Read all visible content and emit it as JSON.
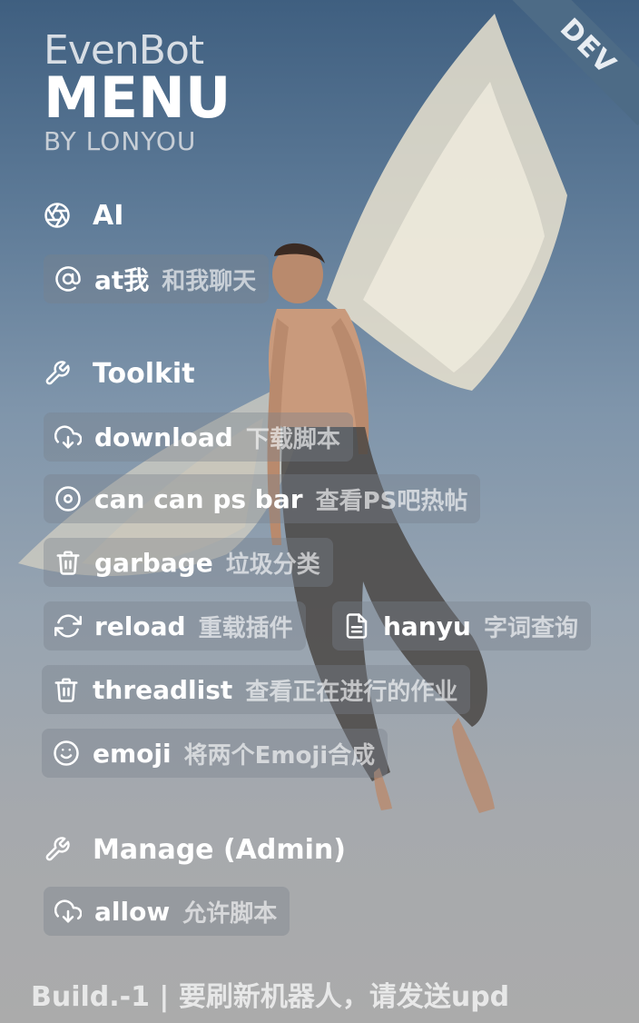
{
  "ribbon": {
    "label": "DEV"
  },
  "logo": {
    "line1": "EvenBot",
    "line2": "MENU",
    "line3": "BY LONYOU"
  },
  "sections": {
    "ai": {
      "title": "AI",
      "icon": "aperture-icon"
    },
    "toolkit": {
      "title": "Toolkit",
      "icon": "wrench-icon"
    },
    "manage": {
      "title": "Manage (Admin)",
      "icon": "wrench-icon"
    }
  },
  "commands": {
    "at": {
      "cmd": "at我",
      "desc": "和我聊天",
      "icon": "at-icon"
    },
    "download": {
      "cmd": "download",
      "desc": "下载脚本",
      "icon": "cloud-download-icon"
    },
    "canps": {
      "cmd": "can can ps bar",
      "desc": "查看PS吧热帖",
      "icon": "disc-icon"
    },
    "garbage": {
      "cmd": "garbage",
      "desc": "垃圾分类",
      "icon": "trash-icon"
    },
    "reload": {
      "cmd": "reload",
      "desc": "重载插件",
      "icon": "refresh-icon"
    },
    "hanyu": {
      "cmd": "hanyu",
      "desc": "字词查询",
      "icon": "document-icon"
    },
    "threadlist": {
      "cmd": "threadlist",
      "desc": "查看正在进行的作业",
      "icon": "trash-icon"
    },
    "emoji": {
      "cmd": "emoji",
      "desc": "将两个Emoji合成",
      "icon": "smile-icon"
    },
    "allow": {
      "cmd": "allow",
      "desc": "允许脚本",
      "icon": "cloud-download-icon"
    }
  },
  "footer": {
    "text": "Build.-1 | 要刷新机器人，请发送upd"
  }
}
